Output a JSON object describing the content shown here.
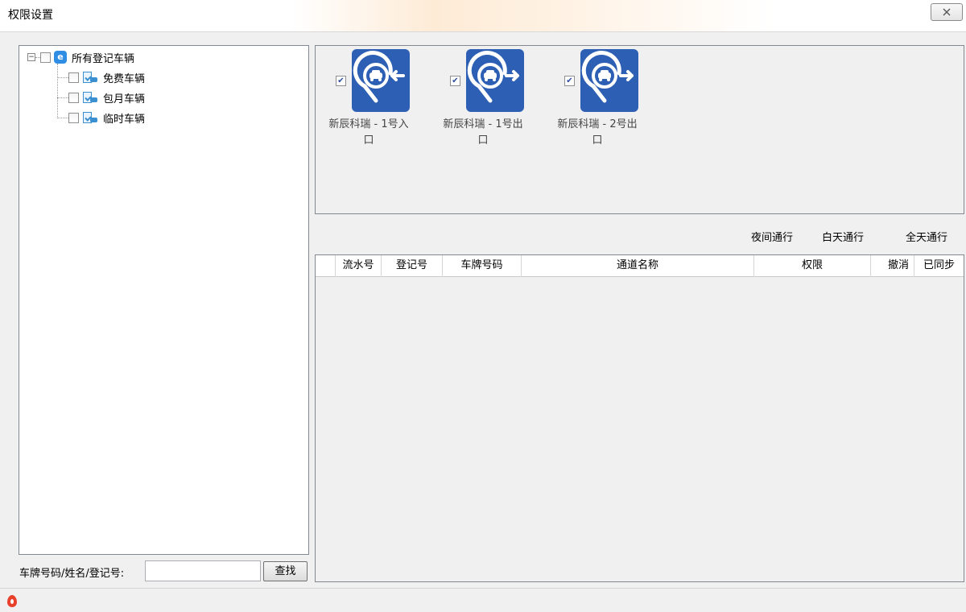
{
  "window": {
    "title": "权限设置",
    "close_label": "ꔰ"
  },
  "tree": {
    "root": {
      "label": "所有登记车辆",
      "icon": "app-logo-icon",
      "expander": "−"
    },
    "children": [
      {
        "label": "免费车辆",
        "icon": "vehicle-category-icon"
      },
      {
        "label": "包月车辆",
        "icon": "vehicle-category-icon"
      },
      {
        "label": "临时车辆",
        "icon": "vehicle-category-icon"
      }
    ]
  },
  "search": {
    "label": "车牌号码/姓名/登记号:",
    "value": "",
    "button_label": "查找"
  },
  "gates": [
    {
      "label_line1": "新辰科瑞 - 1号入",
      "label_line2": "口",
      "checked": true,
      "icon": "gate-entry-icon"
    },
    {
      "label_line1": "新辰科瑞 - 1号出",
      "label_line2": "口",
      "checked": true,
      "icon": "gate-exit-icon"
    },
    {
      "label_line1": "新辰科瑞 - 2号出",
      "label_line2": "口",
      "checked": true,
      "icon": "gate-exit-icon"
    }
  ],
  "toolbar": {
    "night_label": "夜间通行",
    "day_label": "白天通行",
    "allday_label": "全天通行"
  },
  "grid": {
    "columns": [
      "流水号",
      "登记号",
      "车牌号码",
      "通道名称",
      "权限",
      "撤消",
      "已同步"
    ],
    "rows": []
  },
  "colors": {
    "gate_tile": "#2d5fb4",
    "logo": "#2f8de4"
  }
}
